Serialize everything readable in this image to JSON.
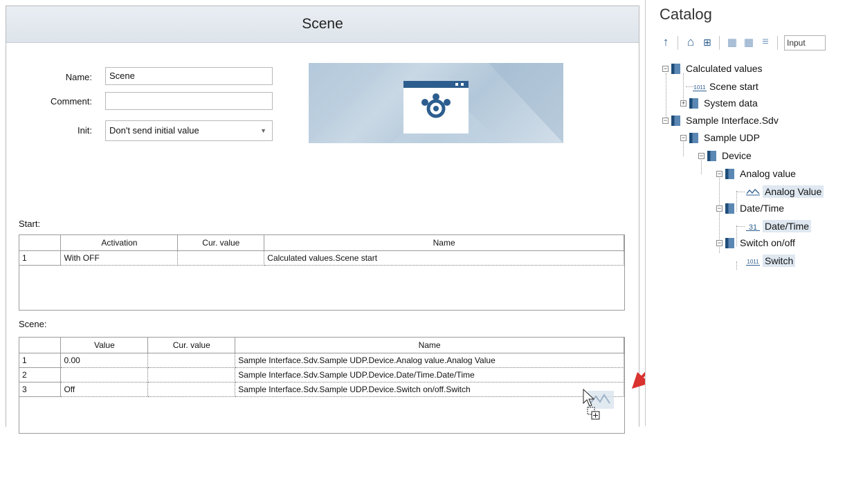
{
  "editor": {
    "title": "Scene",
    "form": {
      "name_label": "Name:",
      "name_value": "Scene",
      "comment_label": "Comment:",
      "comment_value": "",
      "init_label": "Init:",
      "init_value": "Don't send initial value"
    },
    "start": {
      "label": "Start:",
      "columns": [
        "Activation",
        "Cur. value",
        "Name"
      ],
      "rows": [
        {
          "num": "1",
          "activation": "With OFF",
          "cur_value": "",
          "name": "Calculated values.Scene start"
        }
      ]
    },
    "scene": {
      "label": "Scene:",
      "columns": [
        "Value",
        "Cur. value",
        "Name"
      ],
      "rows": [
        {
          "num": "1",
          "value": "0.00",
          "cur_value": "",
          "name": "Sample Interface.Sdv.Sample UDP.Device.Analog value.Analog Value"
        },
        {
          "num": "2",
          "value": "",
          "cur_value": "",
          "name": "Sample Interface.Sdv.Sample UDP.Device.Date/Time.Date/Time"
        },
        {
          "num": "3",
          "value": "Off",
          "cur_value": "",
          "name": "Sample Interface.Sdv.Sample UDP.Device.Switch on/off.Switch"
        }
      ]
    }
  },
  "catalog": {
    "title": "Catalog",
    "filter_value": "Input",
    "tree": {
      "calculated_values": "Calculated values",
      "scene_start": "Scene start",
      "system_data": "System data",
      "sample_interface": "Sample Interface.Sdv",
      "sample_udp": "Sample UDP",
      "device": "Device",
      "analog_value_folder": "Analog value",
      "analog_value_item": "Analog Value",
      "date_time_folder": "Date/Time",
      "date_time_item": "Date/Time",
      "switch_folder": "Switch on/off",
      "switch_item": "Switch"
    },
    "icons": {
      "binary_badge": "1011",
      "calendar_badge": "31"
    }
  },
  "colors": {
    "accent": "#2a5b8c",
    "arrow": "#d9322f",
    "selection": "#dfe8f1"
  }
}
